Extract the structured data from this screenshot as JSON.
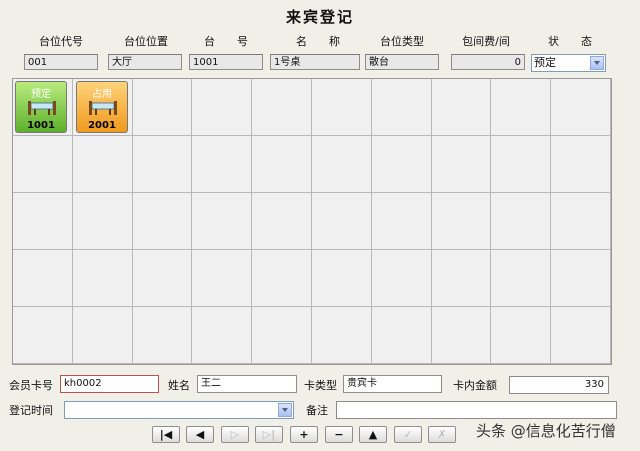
{
  "title": "来宾登记",
  "header_columns": [
    "台位代号",
    "台位位置",
    "台　　号",
    "名　　称",
    "台位类型",
    "包间费/间",
    "状　　态"
  ],
  "fields": {
    "code": "001",
    "location": "大厅",
    "table_no": "1001",
    "name": "1号桌",
    "type": "散台",
    "room_fee": "0",
    "status": "预定"
  },
  "tables": [
    {
      "status": "预定",
      "number": "1001",
      "color": "#6cc03a"
    },
    {
      "status": "占用",
      "number": "2001",
      "color": "#f2a128"
    }
  ],
  "member": {
    "card_label": "会员卡号",
    "card_value": "kh0002",
    "name_label": "姓名",
    "name_value": "王二",
    "card_type_label": "卡类型",
    "card_type_value": "贵宾卡",
    "balance_label": "卡内金额",
    "balance_value": "330",
    "time_label": "登记时间",
    "time_value": "",
    "remark_label": "备注",
    "remark_value": ""
  },
  "nav_buttons": [
    {
      "name": "first-record-button",
      "glyph": "|◀",
      "enabled": true
    },
    {
      "name": "prev-record-button",
      "glyph": "◀",
      "enabled": true
    },
    {
      "name": "next-record-button",
      "glyph": "▷",
      "enabled": false
    },
    {
      "name": "last-record-button",
      "glyph": "▷|",
      "enabled": false
    },
    {
      "name": "add-record-button",
      "glyph": "+",
      "enabled": true
    },
    {
      "name": "delete-record-button",
      "glyph": "−",
      "enabled": true
    },
    {
      "name": "edit-record-button",
      "glyph": "▲",
      "enabled": true
    },
    {
      "name": "save-record-button",
      "glyph": "✓",
      "enabled": false
    },
    {
      "name": "cancel-record-button",
      "glyph": "✗",
      "enabled": false
    }
  ],
  "watermark": "头条 @信息化苦行僧"
}
